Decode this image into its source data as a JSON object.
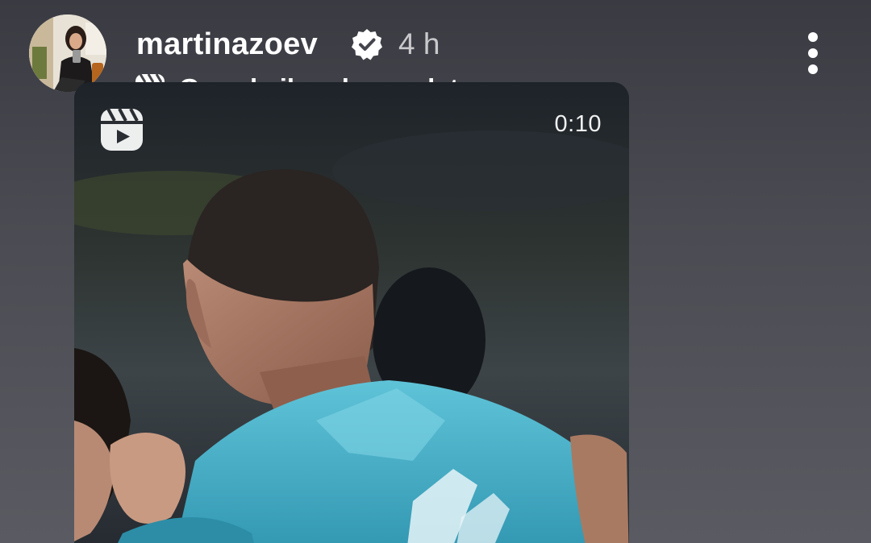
{
  "post": {
    "username": "martinazoev",
    "verified": true,
    "time_ago": "4 h",
    "reel_link_label": "Guarda il reel completo"
  },
  "media": {
    "duration": "0:10"
  },
  "icons": {
    "verified": "verified-badge-icon",
    "reel": "reels-icon",
    "more": "more-vertical-icon"
  },
  "colors": {
    "verified_badge": "#ffffff",
    "background": "#45464d"
  }
}
